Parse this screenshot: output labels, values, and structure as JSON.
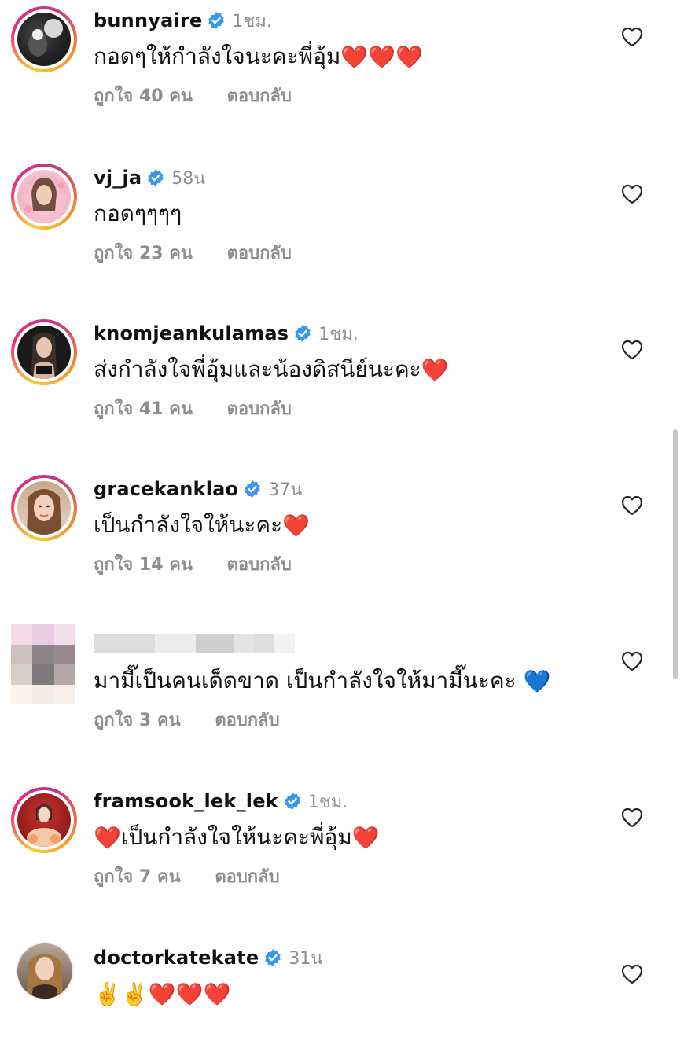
{
  "comments": [
    {
      "username": "bunnyaire",
      "time": "1ชม.",
      "text": "กอดๆให้กำลังใจนะคะพี่อุ้ม",
      "emoji": "❤️❤️❤️",
      "likes": "ถูกใจ 40 คน",
      "reply": "ตอบกลับ"
    },
    {
      "username": "vj_ja",
      "time": "58น",
      "text": "กอดๆๆๆๆ",
      "emoji": "",
      "likes": "ถูกใจ 23 คน",
      "reply": "ตอบกลับ"
    },
    {
      "username": "knomjeankulamas",
      "time": "1ชม.",
      "text": "ส่งกำลังใจพี่อุ้มและน้องดิสนีย์นะคะ",
      "emoji": "❤️",
      "likes": "ถูกใจ 41 คน",
      "reply": "ตอบกลับ"
    },
    {
      "username": "gracekanklao",
      "time": "37น",
      "text": "เป็นกำลังใจให้นะคะ",
      "emoji": "❤️",
      "likes": "ถูกใจ 14 คน",
      "reply": "ตอบกลับ"
    },
    {
      "username": "",
      "time": "",
      "text": "มามี๊เป็นคนเด็ดขาด เป็นกำลังใจให้มามี๊นะคะ ",
      "emoji": "💙",
      "likes": "ถูกใจ 3 คน",
      "reply": "ตอบกลับ"
    },
    {
      "username": "framsook_lek_lek",
      "time": "1ชม.",
      "pre_emoji": "❤️",
      "text": "เป็นกำลังใจให้นะคะพี่อุ้ม",
      "emoji": "❤️",
      "likes": "ถูกใจ 7 คน",
      "reply": "ตอบกลับ"
    },
    {
      "username": "doctorkatekate",
      "time": "31น",
      "text": "",
      "emoji": "✌️✌️❤️❤️❤️",
      "likes": "",
      "reply": ""
    }
  ],
  "colors": {
    "heart": "#e8262b",
    "blue_heart": "#3b6fe0",
    "verified": "#3897f0",
    "meta": "#8e8e8e"
  },
  "icons": [
    "verified-badge-icon",
    "like-heart-outline-icon"
  ]
}
